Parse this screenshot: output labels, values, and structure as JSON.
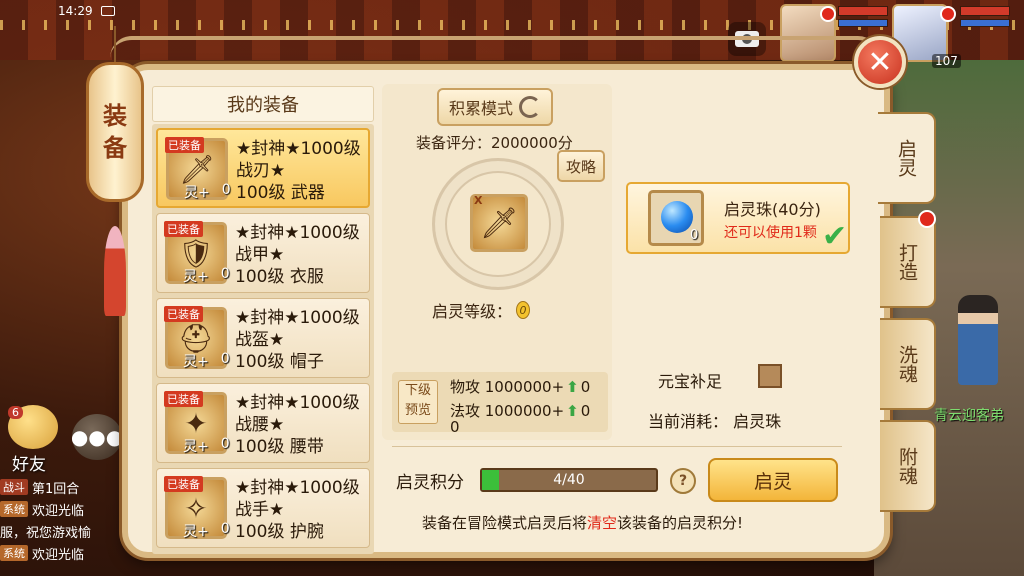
{
  "status": {
    "time": "14:29"
  },
  "hero_level": "107",
  "lantern": {
    "chars": [
      "装",
      "备"
    ]
  },
  "equipment": {
    "header": "我的装备",
    "items": [
      {
        "badge": "已装备",
        "spirit": "灵+",
        "spirit_level": "0",
        "name": "★封神★1000级战刃★",
        "level_slot": "100级 武器",
        "icon": "blade-icon",
        "selected": true
      },
      {
        "badge": "已装备",
        "spirit": "灵+",
        "spirit_level": "0",
        "name": "★封神★1000级战甲★",
        "level_slot": "100级 衣服",
        "icon": "armor-icon",
        "selected": false
      },
      {
        "badge": "已装备",
        "spirit": "灵+",
        "spirit_level": "0",
        "name": "★封神★1000级战盔★",
        "level_slot": "100级 帽子",
        "icon": "helmet-icon",
        "selected": false
      },
      {
        "badge": "已装备",
        "spirit": "灵+",
        "spirit_level": "0",
        "name": "★封神★1000级战腰★",
        "level_slot": "100级 腰带",
        "icon": "belt-icon",
        "selected": false
      },
      {
        "badge": "已装备",
        "spirit": "灵+",
        "spirit_level": "0",
        "name": "★封神★1000级战手★",
        "level_slot": "100级 护腕",
        "icon": "bracer-icon",
        "selected": false
      }
    ]
  },
  "center": {
    "accumulate_mode": "积累模式",
    "score": "装备评分：2000000分",
    "strategy": "攻略",
    "slot_mark": "X",
    "spirit_level_label": "启灵等级：",
    "spirit_level_value": "0"
  },
  "preview": {
    "label_line1": "下级",
    "label_line2": "预览",
    "phys_atk": "物攻 1000000+",
    "phys_atk_gain": "0",
    "mag_atk": "法攻 1000000+",
    "mag_atk_gain": "0",
    "mag_atk_trailing": "0"
  },
  "bead": {
    "name": "启灵珠(40分)",
    "usage": "还可以使用1颗",
    "count": "0"
  },
  "ingot": {
    "label": "元宝补足"
  },
  "consume": {
    "label": "当前消耗：",
    "item": "启灵珠"
  },
  "points": {
    "label": "启灵积分",
    "progress_text": "4/40",
    "progress": 0.1
  },
  "help": "?",
  "activate_button": "启灵",
  "footer": {
    "prefix": "装备在冒险模式启灵后将",
    "highlight": "清空",
    "suffix": "该装备的启灵积分!"
  },
  "tabs": [
    {
      "label": "启灵",
      "active": true
    },
    {
      "label": "打造",
      "active": false
    },
    {
      "label": "洗魂",
      "active": false
    },
    {
      "label": "附魂",
      "active": false
    }
  ],
  "chat": {
    "friend_label": "好友",
    "friend_level": "6",
    "lines": [
      {
        "tag": "战斗",
        "text": "第1回合"
      },
      {
        "tag": "系统",
        "text": "欢迎光临"
      },
      {
        "tag": "",
        "text": "服，祝您游戏愉"
      },
      {
        "tag": "系统",
        "text": "欢迎光临"
      }
    ]
  },
  "npc_name": "青云迎客弟",
  "colors": {
    "accent_gold": "#f3b53a",
    "highlight_red": "#e02a1a",
    "progress_green": "#3cbf3a"
  }
}
